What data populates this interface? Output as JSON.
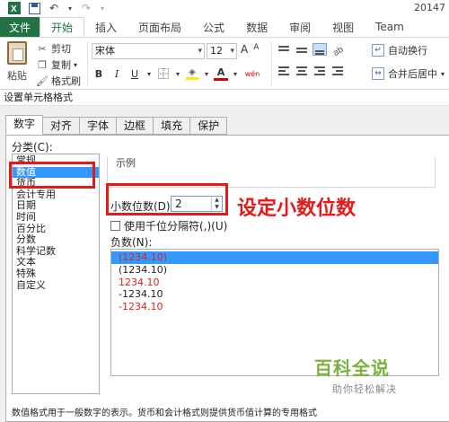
{
  "app": {
    "title_right": "20147"
  },
  "ribbon": {
    "tabs": [
      "文件",
      "开始",
      "插入",
      "页面布局",
      "公式",
      "数据",
      "审阅",
      "视图",
      "Team"
    ],
    "clipboard": {
      "paste_label": "粘贴",
      "cut_label": "剪切",
      "copy_label": "复制",
      "format_painter_label": "格式刷"
    },
    "font": {
      "font_name": "宋体",
      "font_size": "12",
      "grow_label": "A",
      "shrink_label": "A",
      "bold": "B",
      "italic": "I",
      "underline": "U",
      "font_color_label": "A",
      "phonetic_label": "wén"
    },
    "alignment": {
      "wrap_text_label": "自动换行",
      "merge_center_label": "合并后居中"
    }
  },
  "dialog": {
    "title": "设置单元格格式",
    "tabs": [
      "数字",
      "对齐",
      "字体",
      "边框",
      "填充",
      "保护"
    ],
    "active_tab": "数字",
    "category_label": "分类(C):",
    "categories": [
      "常规",
      "数值",
      "货币",
      "会计专用",
      "日期",
      "时间",
      "百分比",
      "分数",
      "科学记数",
      "文本",
      "特殊",
      "自定义"
    ],
    "selected_category": "数值",
    "sample_label": "示例",
    "decimal_label": "小数位数(D):",
    "decimal_value": "2",
    "thousands_label": "使用千位分隔符(,)(U)",
    "negative_label": "负数(N):",
    "negative_options": [
      {
        "text": "(1234.10)",
        "red": true,
        "selected": true
      },
      {
        "text": "(1234.10)",
        "red": false,
        "selected": false
      },
      {
        "text": "1234.10",
        "red": true,
        "selected": false
      },
      {
        "text": "-1234.10",
        "red": false,
        "selected": false
      },
      {
        "text": "-1234.10",
        "red": true,
        "selected": false
      }
    ],
    "description": "数值格式用于一般数字的表示。货币和会计格式则提供货币值计算的专用格式"
  },
  "annotation": {
    "text": "设定小数位数",
    "color": "#e21a1a"
  },
  "watermark": {
    "line1": "百科全说",
    "line2": "助你轻松解决"
  },
  "colors": {
    "excel_green": "#217346",
    "selection_blue": "#3399ff",
    "negative_red": "#e02020"
  }
}
